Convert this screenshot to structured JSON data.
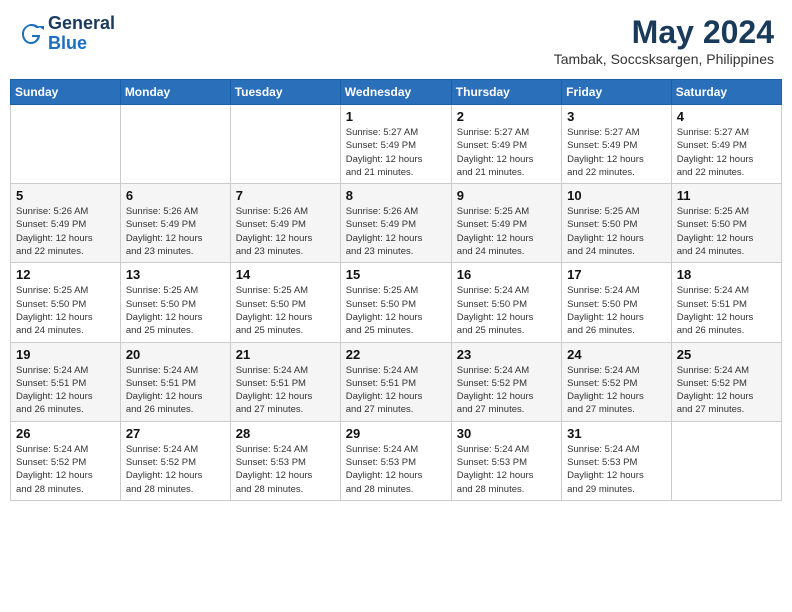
{
  "header": {
    "logo_line1": "General",
    "logo_line2": "Blue",
    "month": "May 2024",
    "location": "Tambak, Soccsksargen, Philippines"
  },
  "weekdays": [
    "Sunday",
    "Monday",
    "Tuesday",
    "Wednesday",
    "Thursday",
    "Friday",
    "Saturday"
  ],
  "weeks": [
    [
      {
        "day": "",
        "info": ""
      },
      {
        "day": "",
        "info": ""
      },
      {
        "day": "",
        "info": ""
      },
      {
        "day": "1",
        "info": "Sunrise: 5:27 AM\nSunset: 5:49 PM\nDaylight: 12 hours\nand 21 minutes."
      },
      {
        "day": "2",
        "info": "Sunrise: 5:27 AM\nSunset: 5:49 PM\nDaylight: 12 hours\nand 21 minutes."
      },
      {
        "day": "3",
        "info": "Sunrise: 5:27 AM\nSunset: 5:49 PM\nDaylight: 12 hours\nand 22 minutes."
      },
      {
        "day": "4",
        "info": "Sunrise: 5:27 AM\nSunset: 5:49 PM\nDaylight: 12 hours\nand 22 minutes."
      }
    ],
    [
      {
        "day": "5",
        "info": "Sunrise: 5:26 AM\nSunset: 5:49 PM\nDaylight: 12 hours\nand 22 minutes."
      },
      {
        "day": "6",
        "info": "Sunrise: 5:26 AM\nSunset: 5:49 PM\nDaylight: 12 hours\nand 23 minutes."
      },
      {
        "day": "7",
        "info": "Sunrise: 5:26 AM\nSunset: 5:49 PM\nDaylight: 12 hours\nand 23 minutes."
      },
      {
        "day": "8",
        "info": "Sunrise: 5:26 AM\nSunset: 5:49 PM\nDaylight: 12 hours\nand 23 minutes."
      },
      {
        "day": "9",
        "info": "Sunrise: 5:25 AM\nSunset: 5:49 PM\nDaylight: 12 hours\nand 24 minutes."
      },
      {
        "day": "10",
        "info": "Sunrise: 5:25 AM\nSunset: 5:50 PM\nDaylight: 12 hours\nand 24 minutes."
      },
      {
        "day": "11",
        "info": "Sunrise: 5:25 AM\nSunset: 5:50 PM\nDaylight: 12 hours\nand 24 minutes."
      }
    ],
    [
      {
        "day": "12",
        "info": "Sunrise: 5:25 AM\nSunset: 5:50 PM\nDaylight: 12 hours\nand 24 minutes."
      },
      {
        "day": "13",
        "info": "Sunrise: 5:25 AM\nSunset: 5:50 PM\nDaylight: 12 hours\nand 25 minutes."
      },
      {
        "day": "14",
        "info": "Sunrise: 5:25 AM\nSunset: 5:50 PM\nDaylight: 12 hours\nand 25 minutes."
      },
      {
        "day": "15",
        "info": "Sunrise: 5:25 AM\nSunset: 5:50 PM\nDaylight: 12 hours\nand 25 minutes."
      },
      {
        "day": "16",
        "info": "Sunrise: 5:24 AM\nSunset: 5:50 PM\nDaylight: 12 hours\nand 25 minutes."
      },
      {
        "day": "17",
        "info": "Sunrise: 5:24 AM\nSunset: 5:50 PM\nDaylight: 12 hours\nand 26 minutes."
      },
      {
        "day": "18",
        "info": "Sunrise: 5:24 AM\nSunset: 5:51 PM\nDaylight: 12 hours\nand 26 minutes."
      }
    ],
    [
      {
        "day": "19",
        "info": "Sunrise: 5:24 AM\nSunset: 5:51 PM\nDaylight: 12 hours\nand 26 minutes."
      },
      {
        "day": "20",
        "info": "Sunrise: 5:24 AM\nSunset: 5:51 PM\nDaylight: 12 hours\nand 26 minutes."
      },
      {
        "day": "21",
        "info": "Sunrise: 5:24 AM\nSunset: 5:51 PM\nDaylight: 12 hours\nand 27 minutes."
      },
      {
        "day": "22",
        "info": "Sunrise: 5:24 AM\nSunset: 5:51 PM\nDaylight: 12 hours\nand 27 minutes."
      },
      {
        "day": "23",
        "info": "Sunrise: 5:24 AM\nSunset: 5:52 PM\nDaylight: 12 hours\nand 27 minutes."
      },
      {
        "day": "24",
        "info": "Sunrise: 5:24 AM\nSunset: 5:52 PM\nDaylight: 12 hours\nand 27 minutes."
      },
      {
        "day": "25",
        "info": "Sunrise: 5:24 AM\nSunset: 5:52 PM\nDaylight: 12 hours\nand 27 minutes."
      }
    ],
    [
      {
        "day": "26",
        "info": "Sunrise: 5:24 AM\nSunset: 5:52 PM\nDaylight: 12 hours\nand 28 minutes."
      },
      {
        "day": "27",
        "info": "Sunrise: 5:24 AM\nSunset: 5:52 PM\nDaylight: 12 hours\nand 28 minutes."
      },
      {
        "day": "28",
        "info": "Sunrise: 5:24 AM\nSunset: 5:53 PM\nDaylight: 12 hours\nand 28 minutes."
      },
      {
        "day": "29",
        "info": "Sunrise: 5:24 AM\nSunset: 5:53 PM\nDaylight: 12 hours\nand 28 minutes."
      },
      {
        "day": "30",
        "info": "Sunrise: 5:24 AM\nSunset: 5:53 PM\nDaylight: 12 hours\nand 28 minutes."
      },
      {
        "day": "31",
        "info": "Sunrise: 5:24 AM\nSunset: 5:53 PM\nDaylight: 12 hours\nand 29 minutes."
      },
      {
        "day": "",
        "info": ""
      }
    ]
  ]
}
